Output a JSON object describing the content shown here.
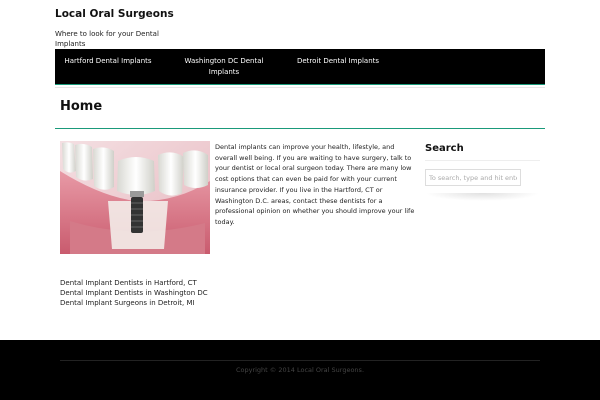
{
  "site": {
    "title": "Local Oral Surgeons",
    "tagline": "Where to look for your Dental Implants"
  },
  "nav": {
    "items": [
      {
        "label": "Hartford Dental Implants"
      },
      {
        "label": "Washington DC Dental Implants"
      },
      {
        "label": "Detroit Dental Implants"
      }
    ]
  },
  "page": {
    "title": "Home",
    "body": "Dental implants can improve your health, lifestyle, and overall well being. If you are waiting to have surgery, talk to your dentist or local oral surgeon today. There are many low cost options that can even be paid for with your current insurance provider. If you live in the Hartford, CT or Washington D.C. areas, contact these dentists for a professional opinion on whether you should improve your life today.",
    "links": [
      {
        "label": "Dental Implant Dentists in Hartford, CT"
      },
      {
        "label": "Dental Implant Dentists in Washington DC"
      },
      {
        "label": "Dental Implant Surgeons in Detroit, MI"
      }
    ]
  },
  "sidebar": {
    "search_title": "Search",
    "search_placeholder": "To search, type and hit enter"
  },
  "footer": {
    "copyright": "Copyright © 2014 Local Oral Surgeons."
  },
  "colors": {
    "accent": "#1a9a7a",
    "nav_bg": "#000000",
    "footer_bg": "#000000"
  }
}
